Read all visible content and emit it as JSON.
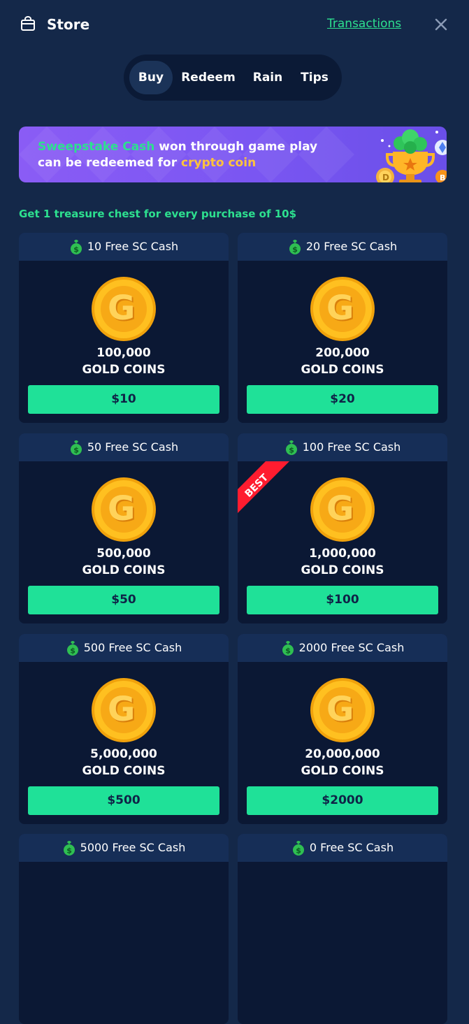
{
  "header": {
    "title": "Store",
    "transactions_label": "Transactions",
    "icons": {
      "store": "shopping-bag-icon",
      "close": "close-icon"
    }
  },
  "tabs": [
    {
      "label": "Buy",
      "active": true
    },
    {
      "label": "Redeem",
      "active": false
    },
    {
      "label": "Rain",
      "active": false
    },
    {
      "label": "Tips",
      "active": false
    }
  ],
  "banner": {
    "part1": "Sweepstake Cash",
    "part2": " won through game play",
    "part3": "can be redeemed for ",
    "part4": "crypto coin"
  },
  "promo_text": "Get 1 treasure chest for every purchase of 10$",
  "packages": [
    {
      "bonus": "10 Free SC Cash",
      "amount": "100,000",
      "unit": "GOLD COINS",
      "price": "$10"
    },
    {
      "bonus": "20 Free SC Cash",
      "amount": "200,000",
      "unit": "GOLD COINS",
      "price": "$20"
    },
    {
      "bonus": "50 Free SC Cash",
      "amount": "500,000",
      "unit": "GOLD COINS",
      "price": "$50"
    },
    {
      "bonus": "100 Free SC Cash",
      "amount": "1,000,000",
      "unit": "GOLD COINS",
      "price": "$100",
      "ribbon": "BEST"
    },
    {
      "bonus": "500 Free SC Cash",
      "amount": "5,000,000",
      "unit": "GOLD COINS",
      "price": "$500"
    },
    {
      "bonus": "2000 Free SC Cash",
      "amount": "20,000,000",
      "unit": "GOLD COINS",
      "price": "$2000"
    },
    {
      "bonus": "5000 Free SC Cash"
    },
    {
      "bonus": "0 Free SC Cash"
    }
  ],
  "colors": {
    "background": "#142849",
    "card": "#0b1834",
    "card_header": "#162e57",
    "accent_green": "#1fe198",
    "banner_purple": "#7a56f2",
    "gold": "#ffc33b",
    "ribbon_red": "#ff1c2f"
  }
}
